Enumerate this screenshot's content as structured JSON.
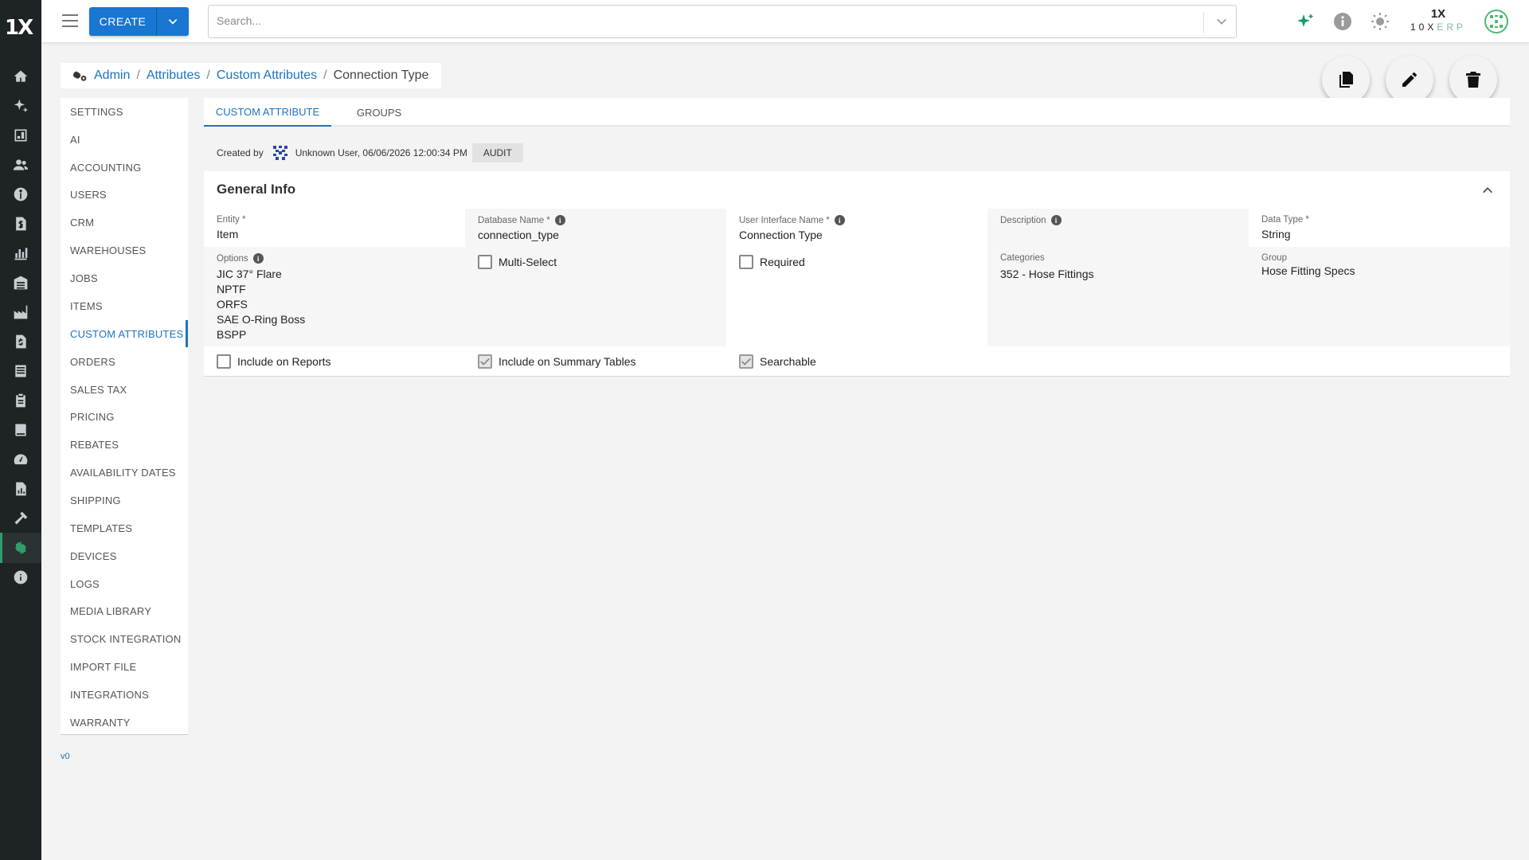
{
  "rail": {
    "logo": "1X",
    "icons": [
      "home-icon",
      "sparkle-icon",
      "dashboard-icon",
      "people-icon",
      "compass-icon",
      "invoice-icon",
      "chart-icon",
      "warehouse-icon",
      "factory-icon",
      "billing-icon",
      "list-icon",
      "clipboard-icon",
      "book-icon",
      "gauge-icon",
      "report-icon",
      "hammer-icon",
      "settings-icon",
      "info-icon"
    ],
    "active": "settings-icon"
  },
  "topbar": {
    "create_label": "CREATE",
    "search_placeholder": "Search...",
    "brand_mark": "1X",
    "brand_text": "10X",
    "brand_erp": "ERP"
  },
  "breadcrumb": {
    "items": [
      "Admin",
      "Attributes",
      "Custom Attributes"
    ],
    "current": "Connection Type"
  },
  "admin_nav": {
    "items": [
      "SETTINGS",
      "AI",
      "ACCOUNTING",
      "USERS",
      "CRM",
      "WAREHOUSES",
      "JOBS",
      "ITEMS",
      "CUSTOM ATTRIBUTES",
      "ORDERS",
      "SALES TAX",
      "PRICING",
      "REBATES",
      "AVAILABILITY DATES",
      "SHIPPING",
      "TEMPLATES",
      "DEVICES",
      "LOGS",
      "MEDIA LIBRARY",
      "STOCK INTEGRATION",
      "IMPORT FILE",
      "INTEGRATIONS",
      "WARRANTY"
    ],
    "active": "CUSTOM ATTRIBUTES",
    "version": "v0"
  },
  "tabs": [
    "CUSTOM ATTRIBUTE",
    "GROUPS"
  ],
  "created": {
    "label": "Created by",
    "text": "Unknown User, 06/06/2026 12:00:34 PM",
    "audit_label": "AUDIT"
  },
  "general_info": {
    "title": "General Info",
    "entity": {
      "label": "Entity *",
      "value": "Item"
    },
    "database_name": {
      "label": "Database Name *",
      "value": "connection_type"
    },
    "ui_name": {
      "label": "User Interface Name *",
      "value": "Connection Type"
    },
    "description": {
      "label": "Description",
      "value": ""
    },
    "data_type": {
      "label": "Data Type *",
      "value": "String"
    },
    "options": {
      "label": "Options",
      "values": [
        "JIC 37° Flare",
        "NPTF",
        "ORFS",
        "SAE O-Ring Boss",
        "BSPP"
      ]
    },
    "multi_select": {
      "label": "Multi-Select",
      "checked": false
    },
    "required": {
      "label": "Required",
      "checked": false
    },
    "categories": {
      "label": "Categories",
      "value": "352 - Hose Fittings"
    },
    "group": {
      "label": "Group",
      "value": "Hose Fitting Specs"
    },
    "include_on_reports": {
      "label": "Include on Reports",
      "checked": false
    },
    "include_on_summary_tables": {
      "label": "Include on Summary Tables",
      "checked": true
    },
    "searchable": {
      "label": "Searchable",
      "checked": true
    }
  },
  "colors": {
    "accent": "#1976d2",
    "link": "#1e73be",
    "rail": "#1e2325",
    "brand_green": "#2e9e6a"
  }
}
